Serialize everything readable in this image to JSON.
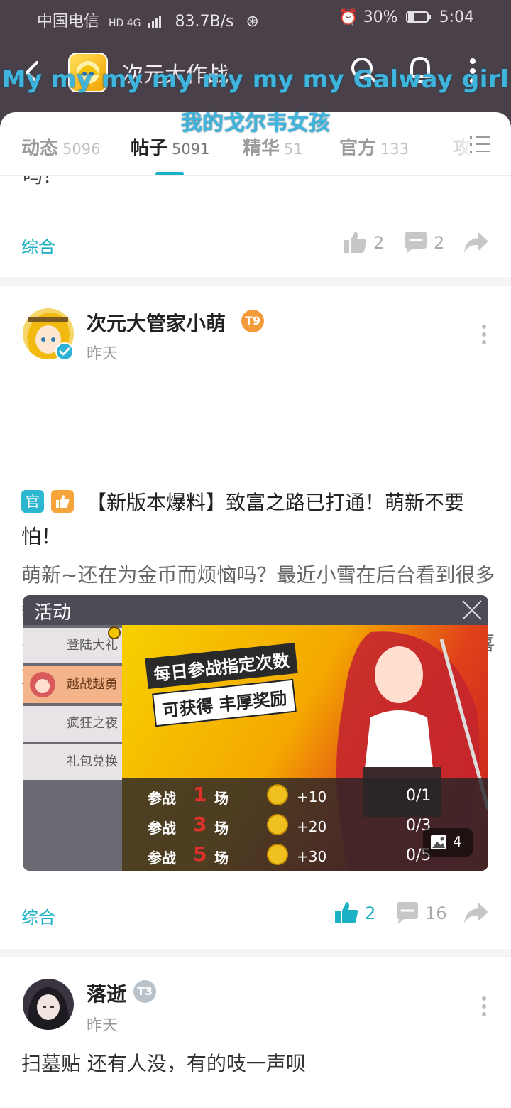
{
  "status_bar": {
    "carrier": "中国电信",
    "network": "HD 4G",
    "speed": "83.7B/s",
    "battery": "30%",
    "time": "5:04"
  },
  "top_bar": {
    "title": "次元大作战"
  },
  "lyrics": {
    "line1": "My my my my my my my Galway girl",
    "line2": "我的戈尔韦女孩"
  },
  "tabs": [
    {
      "label": "动态",
      "count": "5096"
    },
    {
      "label": "帖子",
      "count": "5091"
    },
    {
      "label": "精华",
      "count": "51"
    },
    {
      "label": "官方",
      "count": "133"
    },
    {
      "label": "攻",
      "count": ""
    }
  ],
  "prev_post": {
    "cut_text": "吗？",
    "tag": "综合",
    "likes": "2",
    "comments": "2"
  },
  "post1": {
    "author": "次元大管家小萌",
    "level": "T9",
    "time": "昨天",
    "official_badge": "官",
    "title": "【新版本爆料】致富之路已打通！萌新不要怕！",
    "body": "萌新~还在为金币而烦恼吗？最近小雪在后台看到很多新手都在抱怨，金币好难赚，想买某某某英雄总是攒不够~嘿嘿，不用怕，为了让各位萌新早点拿到自己喜欢的英雄，我们在新版本中增加了金...",
    "image": {
      "header": "活动",
      "menu": [
        "登陆大礼",
        "越战越勇",
        "疯狂之夜",
        "礼包兑换"
      ],
      "banner_line1": "每日参战指定次数",
      "banner_line2": "可获得 丰厚奖励",
      "rows": [
        {
          "label_pre": "参战",
          "num": "1",
          "label_post": "场",
          "reward": "+10",
          "progress": "0/1"
        },
        {
          "label_pre": "参战",
          "num": "3",
          "label_post": "场",
          "reward": "+20",
          "progress": "0/3"
        },
        {
          "label_pre": "参战",
          "num": "5",
          "label_post": "场",
          "reward": "+30",
          "progress": "0/5"
        }
      ],
      "count": "4"
    },
    "tag": "综合",
    "likes": "2",
    "comments": "16"
  },
  "post2": {
    "author": "落逝",
    "level": "T3",
    "time": "昨天",
    "body": "扫墓贴 还有人没，有的吱一声呗"
  },
  "colors": {
    "header_bg": "#4a4049",
    "accent": "#1cb0c4",
    "lyrics": "#3fb5dd",
    "level_orange": "#f39a3b",
    "level_gray": "#b9c2c9"
  }
}
